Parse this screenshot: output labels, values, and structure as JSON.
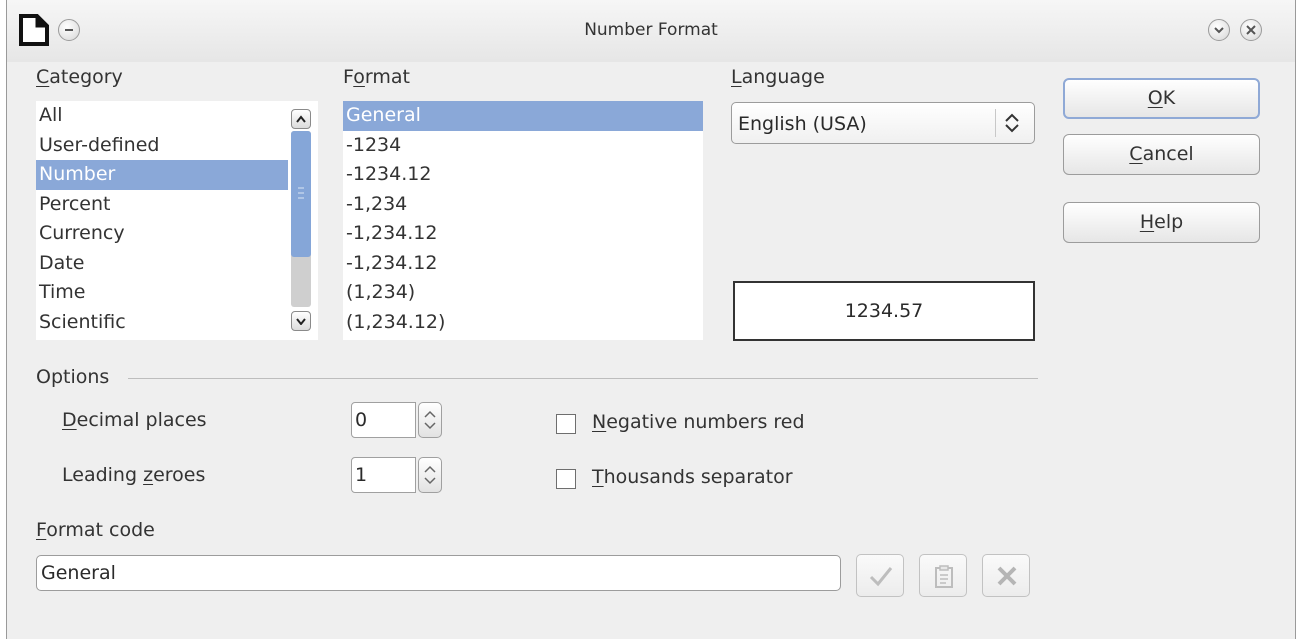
{
  "window": {
    "title": "Number Format"
  },
  "category": {
    "label_u": "C",
    "label_rest": "ategory",
    "items": [
      "All",
      "User-defined",
      "Number",
      "Percent",
      "Currency",
      "Date",
      "Time",
      "Scientific"
    ],
    "selected_index": 2
  },
  "format": {
    "label_pre": "F",
    "label_u": "o",
    "label_rest": "rmat",
    "items": [
      "General",
      "-1234",
      "-1234.12",
      "-1,234",
      "-1,234.12",
      "-1,234.12",
      "(1,234)",
      "(1,234.12)"
    ],
    "selected_index": 0
  },
  "language": {
    "label_u": "L",
    "label_rest": "anguage",
    "value": "English (USA)"
  },
  "preview": {
    "value": "1234.57"
  },
  "buttons": {
    "ok": {
      "u": "O",
      "rest": "K"
    },
    "cancel": {
      "u": "C",
      "rest": "ancel"
    },
    "help": {
      "u": "H",
      "rest": "elp"
    }
  },
  "options": {
    "label": "Options",
    "decimal_places": {
      "u": "D",
      "rest": "ecimal places",
      "value": "0"
    },
    "leading_zeroes": {
      "pre": "Leading ",
      "u": "z",
      "rest": "eroes",
      "value": "1"
    },
    "negative_red": {
      "u": "N",
      "rest": "egative numbers red",
      "checked": false
    },
    "thousands_sep": {
      "u": "T",
      "rest": "housands separator",
      "checked": false
    }
  },
  "format_code": {
    "label_u": "F",
    "label_rest": "ormat code",
    "value": "General"
  },
  "icons": {
    "app": "document-icon",
    "window_menu": "window-menu-icon",
    "minimize": "chevron-down-icon",
    "close": "close-icon",
    "accept": "checkmark-icon",
    "comment": "edit-comment-icon",
    "delete": "delete-icon"
  }
}
